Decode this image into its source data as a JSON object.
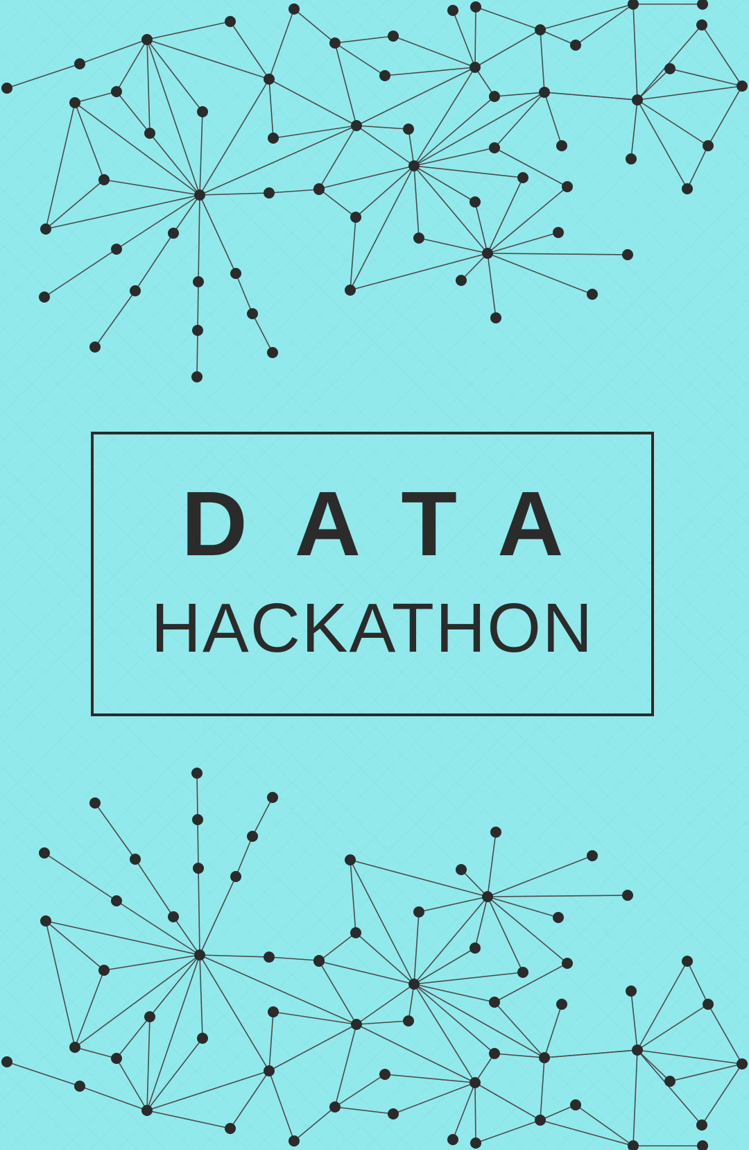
{
  "poster": {
    "title": "DATA",
    "subtitle": "HACKATHON"
  },
  "colors": {
    "background": "#91E9EB",
    "ink": "#2B2B2B"
  },
  "decoration": {
    "top": "network-graph-illustration",
    "bottom": "network-graph-illustration"
  }
}
